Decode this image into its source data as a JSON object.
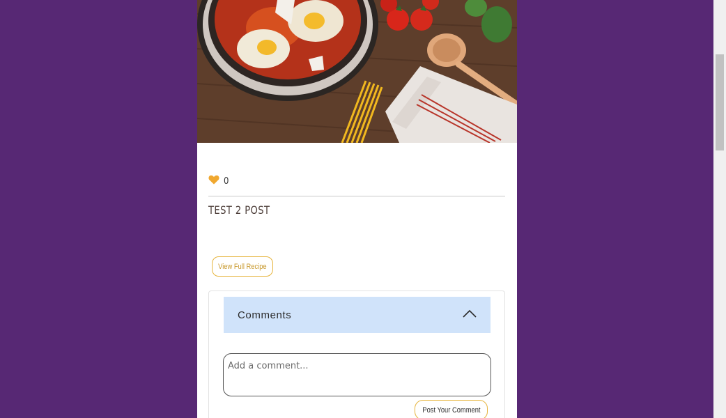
{
  "post": {
    "title": "TEST 2 POST",
    "likes": "0",
    "view_button_label": "View Full Recipe"
  },
  "comments": {
    "header": "Comments",
    "input_placeholder": "Add a comment...",
    "post_button_label": "Post Your Comment"
  },
  "icons": {
    "like": "heart-icon",
    "collapse": "chevron-up-icon"
  },
  "colors": {
    "page_background": "#572874",
    "accent": "#e6b43c",
    "heart": "#f0a830",
    "comments_header_bg": "#d0e3fa"
  }
}
